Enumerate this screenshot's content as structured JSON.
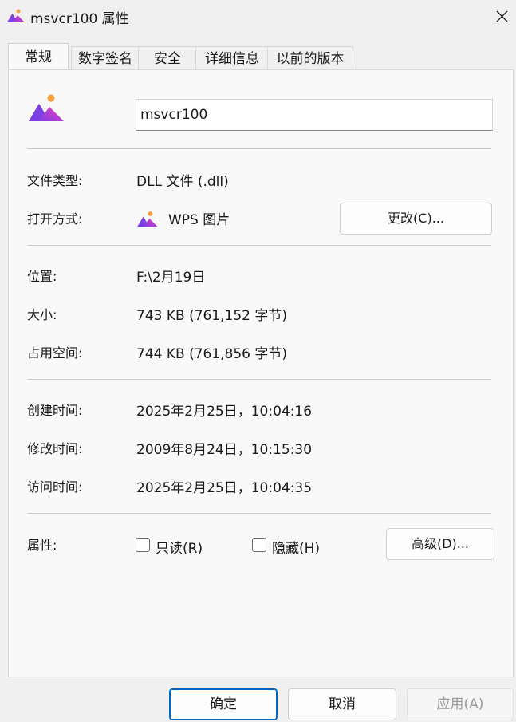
{
  "window": {
    "title": "msvcr100 属性",
    "close_icon": "close-icon"
  },
  "tabs": [
    {
      "label": "常规",
      "active": true
    },
    {
      "label": "数字签名"
    },
    {
      "label": "安全"
    },
    {
      "label": "详细信息"
    },
    {
      "label": "以前的版本"
    }
  ],
  "general": {
    "file_name": "msvcr100",
    "file_type_label": "文件类型:",
    "file_type_value": "DLL 文件 (.dll)",
    "open_with_label": "打开方式:",
    "open_with_value": "WPS 图片",
    "change_button": "更改(C)...",
    "location_label": "位置:",
    "location_value": "F:\\2月19日",
    "size_label": "大小:",
    "size_value": "743 KB (761,152 字节)",
    "disk_size_label": "占用空间:",
    "disk_size_value": "744 KB (761,856 字节)",
    "created_label": "创建时间:",
    "created_value": "2025年2月25日，10:04:16",
    "modified_label": "修改时间:",
    "modified_value": "2009年8月24日，10:15:30",
    "accessed_label": "访问时间:",
    "accessed_value": "2025年2月25日，10:04:35",
    "attributes_label": "属性:",
    "readonly_label": "只读(R)",
    "hidden_label": "隐藏(H)",
    "advanced_button": "高级(D)..."
  },
  "footer": {
    "ok": "确定",
    "cancel": "取消",
    "apply": "应用(A)"
  },
  "colors": {
    "accent": "#0067c0",
    "icon_purple": "#7b3fe4",
    "icon_pink": "#e8408a",
    "icon_orange": "#f59a3c"
  }
}
